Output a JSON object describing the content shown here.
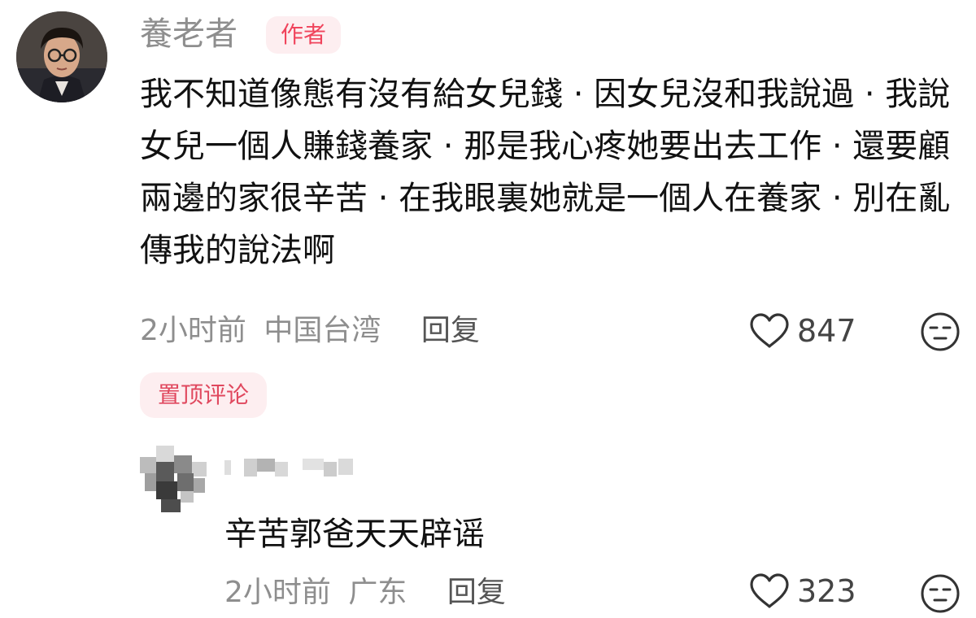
{
  "comment": {
    "username": "養老者",
    "author_badge": "作者",
    "text": "我不知道像態有沒有給女兒錢 · 因女兒沒和我說過 · 我說女兒一個人賺錢養家 · 那是我心疼她要出去工作 · 還要顧兩邊的家很辛苦 · 在我眼裏她就是一個人在養家 · 別在亂傳我的說法啊",
    "time": "2小时前",
    "location": "中国台湾",
    "reply_label": "回复",
    "like_count": "847",
    "pinned_label": "置顶评论"
  },
  "reply": {
    "text": "辛苦郭爸天天辟谣",
    "time": "2小时前",
    "location": "广东",
    "reply_label": "回复",
    "like_count": "323"
  },
  "icons": {
    "like": "heart-outline-icon",
    "emoji": "neutral-face-icon"
  },
  "colors": {
    "accent": "#f0445c",
    "badge_bg": "#fdeef0",
    "meta_text": "#8e8e8e",
    "body_text": "#111111"
  }
}
